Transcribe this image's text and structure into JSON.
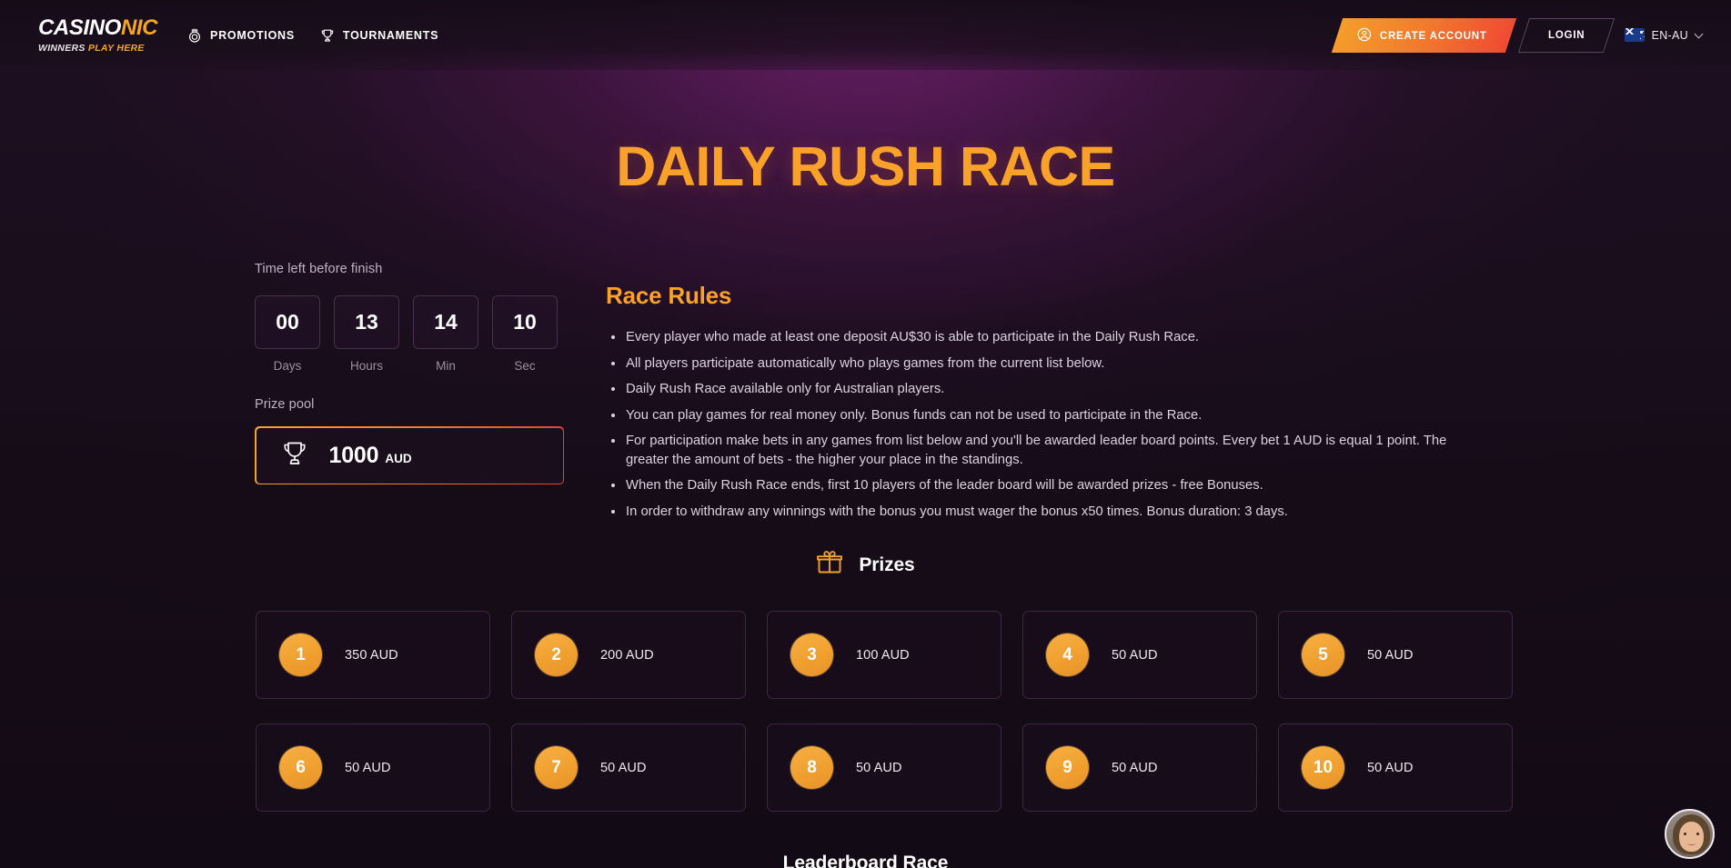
{
  "header": {
    "logo": {
      "name_main": "CASINO",
      "name_accent": "NIC",
      "tagline_1": "WINNERS ",
      "tagline_2": "PLAY HERE"
    },
    "nav": [
      {
        "label": "PROMOTIONS",
        "icon": "promotions-icon"
      },
      {
        "label": "TOURNAMENTS",
        "icon": "trophy-icon"
      }
    ],
    "create_account_label": "CREATE ACCOUNT",
    "login_label": "LOGIN",
    "language": {
      "label": "EN-AU",
      "flag": "au-flag-icon"
    }
  },
  "page_title": "DAILY RUSH RACE",
  "countdown": {
    "label": "Time left before finish",
    "units": [
      {
        "value": "00",
        "name": "Days"
      },
      {
        "value": "13",
        "name": "Hours"
      },
      {
        "value": "14",
        "name": "Min"
      },
      {
        "value": "10",
        "name": "Sec"
      }
    ]
  },
  "prize_pool": {
    "label": "Prize pool",
    "amount": "1000",
    "currency": "AUD",
    "icon": "trophy-icon"
  },
  "rules": {
    "title": "Race Rules",
    "items": [
      "Every player who made at least one deposit AU$30 is able to participate in the Daily Rush Race.",
      "All players participate automatically who plays games from the current list below.",
      "Daily Rush Race available only for Australian players.",
      "You can play games for real money only. Bonus funds can not be used to participate in the Race.",
      "For participation make bets in any games from list below and you'll be awarded leader board points. Every bet 1 AUD is equal 1 point. The greater the amount of bets - the higher your place in the standings.",
      "When the Daily Rush Race ends, first 10 players of the leader board will be awarded prizes - free Bonuses.",
      "In order to withdraw any winnings with the bonus you must wager the bonus x50 times. Bonus duration: 3 days."
    ]
  },
  "prizes": {
    "title": "Prizes",
    "icon": "gift-icon",
    "items": [
      {
        "rank": "1",
        "amount": "350 AUD"
      },
      {
        "rank": "2",
        "amount": "200 AUD"
      },
      {
        "rank": "3",
        "amount": "100 AUD"
      },
      {
        "rank": "4",
        "amount": "50 AUD"
      },
      {
        "rank": "5",
        "amount": "50 AUD"
      },
      {
        "rank": "6",
        "amount": "50 AUD"
      },
      {
        "rank": "7",
        "amount": "50 AUD"
      },
      {
        "rank": "8",
        "amount": "50 AUD"
      },
      {
        "rank": "9",
        "amount": "50 AUD"
      },
      {
        "rank": "10",
        "amount": "50 AUD"
      }
    ]
  },
  "bottom_section_heading": "Leaderboard Race",
  "chat": {
    "icon": "support-agent-avatar"
  },
  "colors": {
    "accent_orange": "#f9a128",
    "gradient_start": "#f5a524",
    "gradient_end": "#ef4a33",
    "background": "#140b15",
    "badge_orange": "#f0a02f"
  }
}
